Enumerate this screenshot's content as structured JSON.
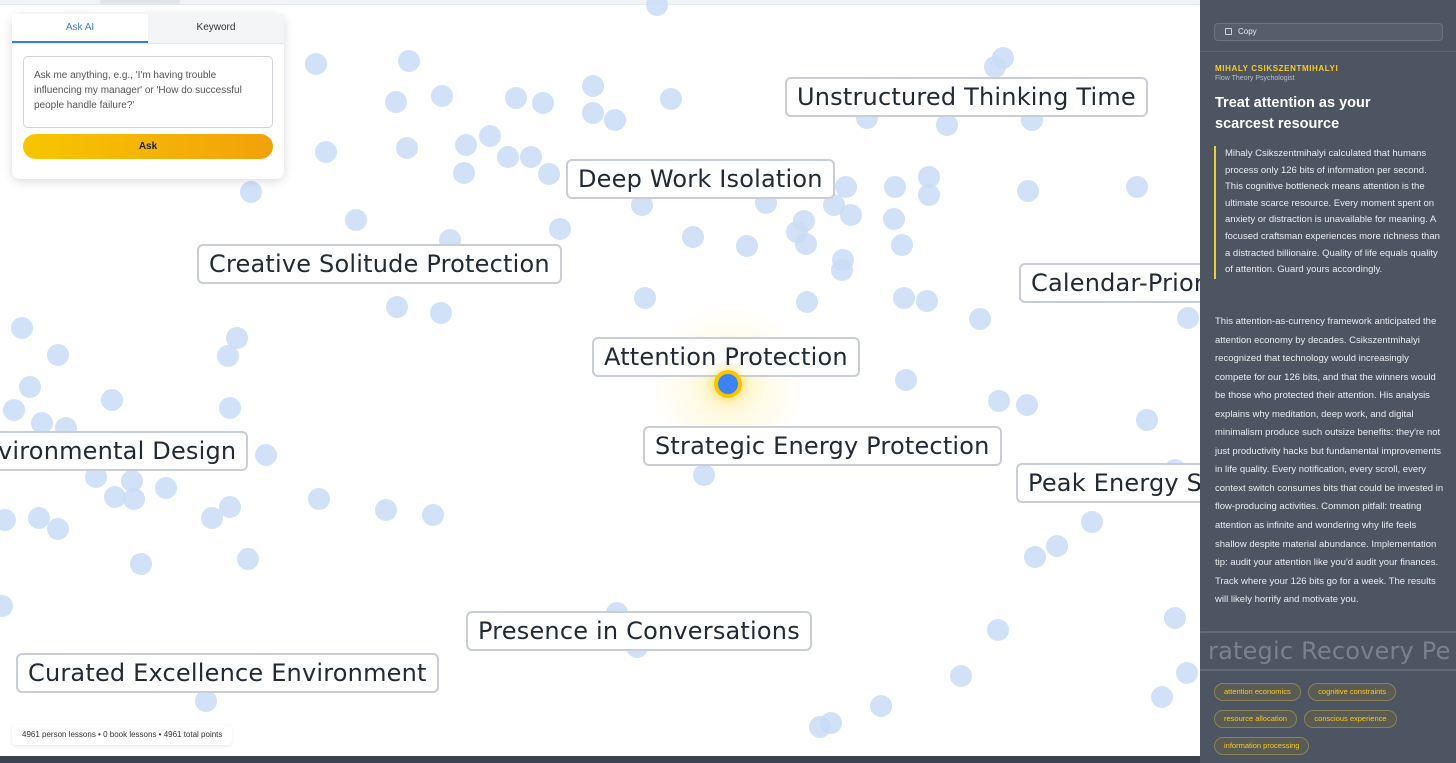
{
  "search": {
    "tabs": [
      {
        "label": "Ask AI",
        "active": true
      },
      {
        "label": "Keyword",
        "active": false
      }
    ],
    "placeholder": "Ask me anything, e.g., 'I'm having trouble influencing my manager' or 'How do successful people handle failure?'",
    "ask_label": "Ask"
  },
  "map": {
    "topics": [
      "Unstructured Thinking Time",
      "Deep Work Isolation",
      "Creative Solitude Protection",
      "Calendar-Prior",
      "Attention Protection",
      "vironmental Design",
      "Strategic Energy Protection",
      "Peak Energy Sc",
      "Presence in Conversations",
      "Curated Excellence Environment",
      "rategic Recovery Pe"
    ],
    "dot_color": "#c9dcf7",
    "selected_color": "#3b82f6",
    "selected_ring": "#f7c600"
  },
  "status": {
    "text": "4961 person lessons • 0 book lessons • 4961 total points"
  },
  "detail": {
    "copy_label": "Copy",
    "copy_icon": "copy-icon",
    "author": "MIHALY CSIKSZENTMIHALYI",
    "role": "Flow Theory Psychologist",
    "title": "Treat attention as your scarcest resource",
    "quote": "Mihaly Csikszentmihalyi calculated that humans process only 126 bits of information per second. This cognitive bottleneck means attention is the ultimate scarce resource. Every moment spent on anxiety or distraction is unavailable for meaning. A focused craftsman experiences more richness than a distracted billionaire. Quality of life equals quality of attention. Guard yours accordingly.",
    "body": "This attention-as-currency framework anticipated the attention economy by decades. Csikszentmihalyi recognized that technology would increasingly compete for our 126 bits, and that the winners would be those who protected their attention. His analysis explains why meditation, deep work, and digital minimalism produce such outsize benefits: they're not just productivity hacks but fundamental improvements in life quality. Every notification, every scroll, every context switch consumes bits that could be invested in flow-producing activities. Common pitfall: treating attention as infinite and wondering why life feels shallow despite material abundance. Implementation tip: audit your attention like you'd audit your finances. Track where your 126 bits go for a week. The results will likely horrify and motivate you.",
    "tags": [
      "attention economics",
      "cognitive constraints",
      "resource allocation",
      "conscious experience",
      "information processing"
    ],
    "accent": "#f5cc2a",
    "background": "#4d5563"
  }
}
